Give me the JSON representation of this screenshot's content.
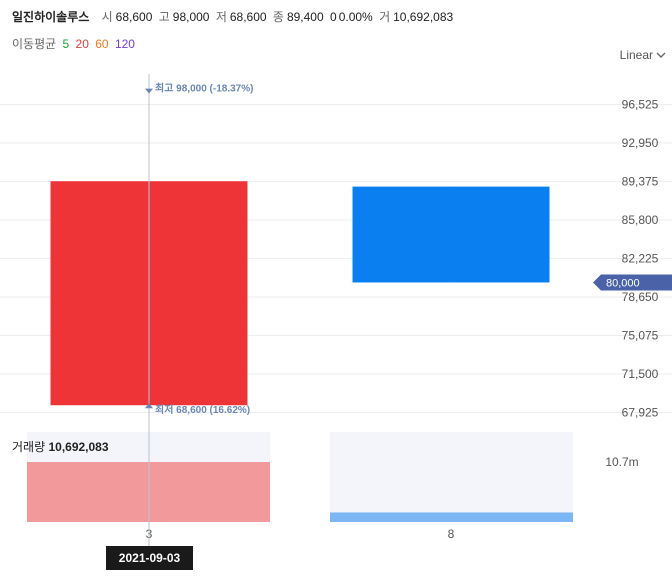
{
  "header": {
    "stock_name": "일진하이솔루스",
    "open_label": "시",
    "open_value": "68,600",
    "high_label": "고",
    "high_value": "98,000",
    "low_label": "저",
    "low_value": "68,600",
    "close_label": "종",
    "close_value": "89,400",
    "change_value": "0",
    "change_pct": "0.00%",
    "volume_label": "거",
    "volume_value": "10,692,083"
  },
  "moving_average": {
    "label": "이동평균",
    "periods": [
      {
        "value": "5",
        "color": "#22a03a"
      },
      {
        "value": "20",
        "color": "#e03c3c"
      },
      {
        "value": "60",
        "color": "#ef7a1a"
      },
      {
        "value": "120",
        "color": "#7a3cdc"
      }
    ]
  },
  "scale_selector": {
    "label": "Linear",
    "icon": "chevron-down-icon"
  },
  "volume_panel": {
    "label": "거래량",
    "value": "10,692,083"
  },
  "crosshair": {
    "date_label": "2021-09-03",
    "current_price_label": "80,000"
  },
  "colors": {
    "up": "#ef3438",
    "down": "#0a7ff0",
    "volume_up": "#f29a9b",
    "volume_down": "#7db6f5",
    "crosshair": "#b8c3d2",
    "annotation": "#6a86b8",
    "current_price_badge": "#4a63a8"
  },
  "chart_data": {
    "type": "candlestick",
    "categories": [
      "3",
      "8"
    ],
    "series": [
      {
        "open": 68600,
        "high": 98000,
        "low": 68600,
        "close": 89400,
        "volume": 10692083
      },
      {
        "open": 88900,
        "high": 88900,
        "low": 80000,
        "close": 80000,
        "volume": 1700000
      }
    ],
    "y_ticks": [
      "96,525",
      "92,950",
      "89,375",
      "85,800",
      "82,225",
      "78,650",
      "75,075",
      "71,500",
      "67,925"
    ],
    "volume_tick": "10.7m",
    "ylim": [
      65000,
      99500
    ],
    "annotations": {
      "high": {
        "label": "최고",
        "value": "98,000",
        "pct": "(-18.37%)"
      },
      "low": {
        "label": "최저",
        "value": "68,600",
        "pct": "(16.62%)"
      }
    }
  }
}
